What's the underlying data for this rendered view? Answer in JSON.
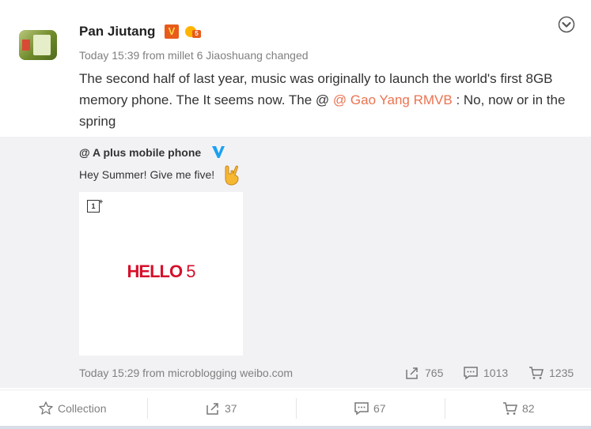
{
  "post": {
    "author": "Pan Jiutang",
    "verified_badge": "V",
    "meta": "Today 15:39 from millet 6 Jiaoshuang changed",
    "text_before": "The second half of last year, music was originally to launch the world's first 8GB memory phone. The It seems now. The @ ",
    "mention": "@ Gao Yang RMVB",
    "text_after": " : No, now or in the spring"
  },
  "repost": {
    "author": "@ A plus mobile phone",
    "text": "Hey Summer! Give me five!",
    "image_text_bold": "HELLO",
    "image_text_num": "5",
    "meta": "Today 15:29 from microblogging weibo.com",
    "stats": {
      "reposts": "765",
      "comments": "1013",
      "likes": "1235"
    }
  },
  "actions": {
    "collection": "Collection",
    "reposts": "37",
    "comments": "67",
    "likes": "82"
  },
  "colors": {
    "mention": "#eb7350",
    "verified": "#1da1f2",
    "accent_red": "#d6102b"
  }
}
